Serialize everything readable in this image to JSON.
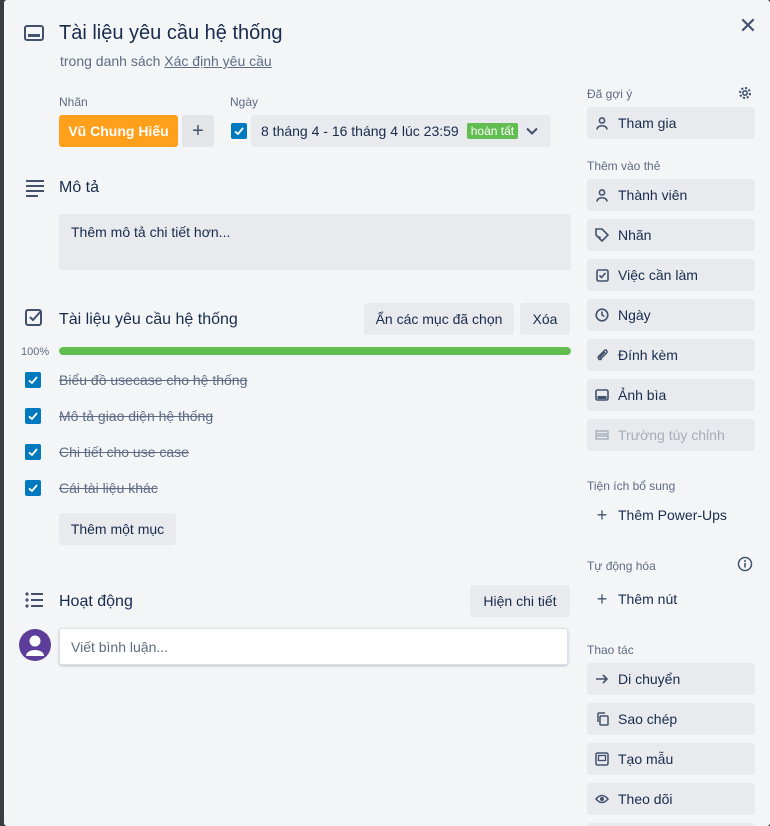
{
  "card": {
    "title": "Tài liệu yêu cầu hệ thống",
    "list_prefix": "trong danh sách ",
    "list_name": "Xác định yêu cầu"
  },
  "labels": {
    "heading": "Nhãn",
    "items": [
      "Vũ Chung Hiếu"
    ],
    "add": "+"
  },
  "dates": {
    "heading": "Ngày",
    "range": "8 tháng 4 - 16 tháng 4 lúc 23:59",
    "status": "hoàn tất",
    "checked": true
  },
  "description": {
    "heading": "Mô tả",
    "placeholder": "Thêm mô tả chi tiết hơn..."
  },
  "checklist": {
    "heading": "Tài liệu yêu cầu hệ thống",
    "hide_checked": "Ẩn các mục đã chọn",
    "delete": "Xóa",
    "progress_label": "100%",
    "progress": 1.0,
    "items": [
      {
        "text": "Biểu đồ usecase cho hệ thống",
        "checked": true
      },
      {
        "text": "Mô tả giao diện hệ thống",
        "checked": true
      },
      {
        "text": "Chi tiết cho use case",
        "checked": true
      },
      {
        "text": "Cái tài liệu khác",
        "checked": true
      }
    ],
    "add_item": "Thêm một mục"
  },
  "activity": {
    "heading": "Hoạt động",
    "show_details": "Hiện chi tiết",
    "comment_placeholder": "Viết bình luận..."
  },
  "sidebar": {
    "suggested": {
      "heading": "Đã gợi ý",
      "items": [
        {
          "label": "Tham gia",
          "icon": "person-icon"
        }
      ]
    },
    "add_to_card": {
      "heading": "Thêm vào thẻ",
      "items": [
        {
          "label": "Thành viên",
          "icon": "person-icon"
        },
        {
          "label": "Nhãn",
          "icon": "tag-icon"
        },
        {
          "label": "Việc cần làm",
          "icon": "checklist-icon"
        },
        {
          "label": "Ngày",
          "icon": "clock-icon"
        },
        {
          "label": "Đính kèm",
          "icon": "paperclip-icon"
        },
        {
          "label": "Ảnh bìa",
          "icon": "card-cover-icon"
        },
        {
          "label": "Trường tùy chỉnh",
          "icon": "custom-field-icon"
        }
      ]
    },
    "power_ups": {
      "heading": "Tiện ích bổ sung",
      "add": "Thêm Power-Ups"
    },
    "automation": {
      "heading": "Tự động hóa",
      "add": "Thêm nút"
    },
    "actions": {
      "heading": "Thao tác",
      "items": [
        {
          "label": "Di chuyển",
          "icon": "arrow-right-icon"
        },
        {
          "label": "Sao chép",
          "icon": "copy-icon"
        },
        {
          "label": "Tạo mẫu",
          "icon": "template-icon"
        },
        {
          "label": "Theo dõi",
          "icon": "eye-icon"
        }
      ]
    }
  },
  "colors": {
    "label_orange": "#ff9f1a",
    "complete_green": "#61bd4f",
    "check_blue": "#0079bf",
    "avatar_purple": "#5c3d99"
  }
}
